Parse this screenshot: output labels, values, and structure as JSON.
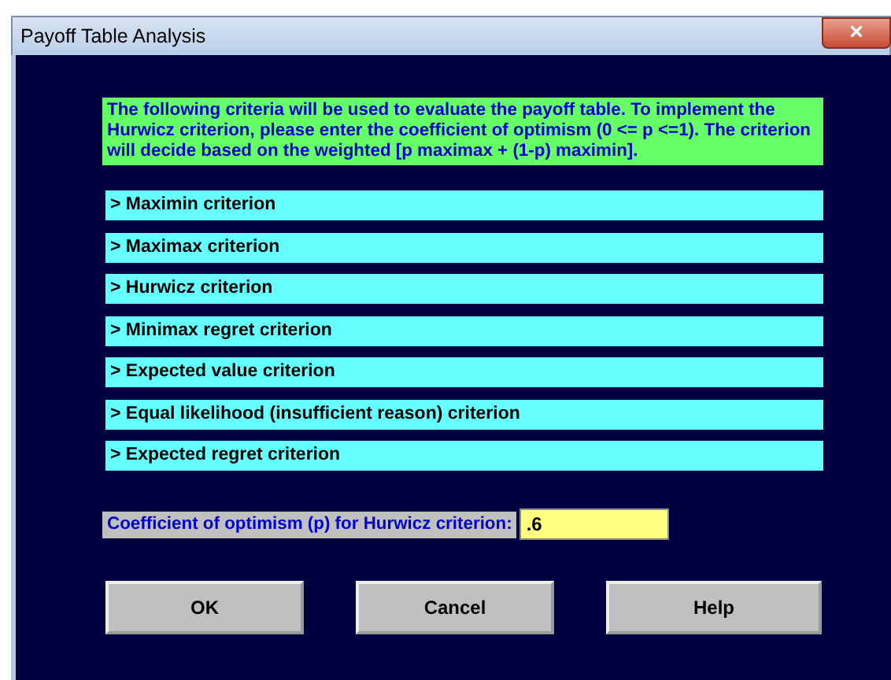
{
  "window": {
    "title": "Payoff Table Analysis",
    "close": "×"
  },
  "intro": "The following criteria will be used to evaluate the payoff table.  To implement the Hurwicz criterion, please enter the coefficient of optimism (0 <= p <=1).  The criterion will decide based on the weighted [p maximax + (1-p) maximin].",
  "criteria": [
    {
      "label": "> Maximin criterion"
    },
    {
      "label": "> Maximax criterion"
    },
    {
      "label": "> Hurwicz criterion"
    },
    {
      "label": "> Minimax regret criterion"
    },
    {
      "label": "> Expected value criterion"
    },
    {
      "label": "> Equal likelihood (insufficient reason) criterion"
    },
    {
      "label": "> Expected regret criterion"
    }
  ],
  "coefficient": {
    "label": "Coefficient of optimism (p) for Hurwicz criterion:",
    "value": ".6"
  },
  "buttons": [
    "OK",
    "Cancel",
    "Help"
  ]
}
